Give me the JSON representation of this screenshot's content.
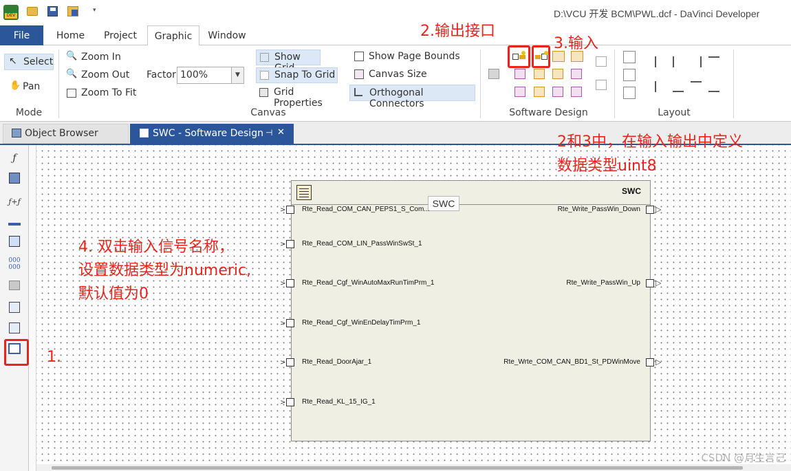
{
  "titlebar": {
    "title": "D:\\VCU 开发 BCM\\PWL.dcf - DaVinci Developer",
    "qa_icons": [
      "app-logo-icon",
      "open-folder-icon",
      "save-icon",
      "save-all-icon",
      "customize-dropdown-icon"
    ]
  },
  "menu": {
    "items": [
      {
        "label": "File"
      },
      {
        "label": "Home"
      },
      {
        "label": "Project"
      },
      {
        "label": "Graphic"
      },
      {
        "label": "Window"
      }
    ],
    "active": "Graphic"
  },
  "ribbon": {
    "mode": {
      "select": "Select",
      "pan": "Pan",
      "group_label": "Mode"
    },
    "canvas": {
      "zoom_in": "Zoom In",
      "zoom_out": "Zoom Out",
      "zoom_to_fit": "Zoom To Fit",
      "factor_label": "Factor",
      "factor_value": "100%",
      "show_grid": "Show Grid",
      "snap_to_grid": "Snap To Grid",
      "grid_properties": "Grid Properties",
      "show_page_bounds": "Show Page Bounds",
      "canvas_size": "Canvas Size",
      "orthogonal_connectors": "Orthogonal Connectors",
      "group_label": "Canvas"
    },
    "software_design": {
      "group_label": "Software Design"
    },
    "layout": {
      "group_label": "Layout"
    }
  },
  "tabs": {
    "object_browser": "Object Browser",
    "swc_design": "SWC - Software Design",
    "pin_glyph": "⊣",
    "close_glyph": "✕"
  },
  "toolbox": {
    "items": [
      "function-icon",
      "runnable-icon",
      "compose-function-icon",
      "connector-icon",
      "component-type-icon",
      "data-elements-icon",
      "module-icon",
      "port-list-icon",
      "port-interface-icon",
      "swc-component-icon"
    ]
  },
  "swc": {
    "title": "SWC",
    "tooltip": "SWC",
    "ports_left": [
      {
        "label": "Rte_Read_COM_CAN_PEPS1_S_Com..."
      },
      {
        "label": "Rte_Read_COM_LIN_PassWinSwSt_1"
      },
      {
        "label": "Rte_Read_Cgf_WinAutoMaxRunTimPrm_1"
      },
      {
        "label": "Rte_Read_Cgf_WinEnDelayTimPrm_1"
      },
      {
        "label": "Rte_Read_DoorAjar_1"
      },
      {
        "label": "Rte_Read_KL_15_IG_1"
      }
    ],
    "ports_right": [
      {
        "label": "Rte_Write_PassWin_Down"
      },
      {
        "label": "Rte_Write_PassWin_Up"
      },
      {
        "label": "Rte_Wrte_COM_CAN_BD1_St_PDWinMove"
      }
    ]
  },
  "annotations": {
    "output": "2.输出接口",
    "input": "3.输入",
    "define_1": "2和3中，在输入输出中定义",
    "define_2": "数据类型uint8",
    "step4_1": "4. 双击输入信号名称，",
    "step4_2": "设置数据类型为numeric,",
    "step4_3": "默认值为0",
    "step1": "1."
  },
  "watermark": "CSDN @月生言己",
  "colors": {
    "accent": "#2b579a",
    "annotation": "#e8251c",
    "swc_fill": "#efefe4"
  }
}
